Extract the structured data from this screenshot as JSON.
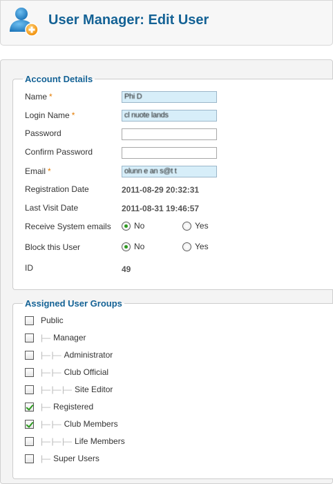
{
  "header": {
    "title": "User Manager: Edit User",
    "icon": "user-add-icon"
  },
  "account": {
    "legend": "Account Details",
    "fields": {
      "name": {
        "label": "Name",
        "required": "*",
        "value": "Phi    D"
      },
      "login": {
        "label": "Login Name",
        "required": "*",
        "value": "cl  nuote  lands"
      },
      "password": {
        "label": "Password",
        "value": ""
      },
      "confirm": {
        "label": "Confirm Password",
        "value": ""
      },
      "email": {
        "label": "Email",
        "required": "*",
        "value": "olunn   e  an   s@t       t"
      },
      "regdate": {
        "label": "Registration Date",
        "value": "2011-08-29 20:32:31"
      },
      "lastvisit": {
        "label": "Last Visit Date",
        "value": "2011-08-31 19:46:57"
      },
      "sysemails": {
        "label": "Receive System emails",
        "options": [
          "No",
          "Yes"
        ],
        "selected": "No"
      },
      "block": {
        "label": "Block this User",
        "options": [
          "No",
          "Yes"
        ],
        "selected": "No"
      },
      "id": {
        "label": "ID",
        "value": "49"
      }
    }
  },
  "groups": {
    "legend": "Assigned User Groups",
    "items": [
      {
        "label": "Public",
        "prefix": "",
        "checked": false
      },
      {
        "label": "Manager",
        "prefix": "|—",
        "checked": false
      },
      {
        "label": "Administrator",
        "prefix": "|— |—",
        "checked": false
      },
      {
        "label": "Club Official",
        "prefix": "|— |—",
        "checked": false
      },
      {
        "label": "Site Editor",
        "prefix": "|— |— |—",
        "checked": false
      },
      {
        "label": "Registered",
        "prefix": "|—",
        "checked": true
      },
      {
        "label": "Club Members",
        "prefix": "|— |—",
        "checked": true
      },
      {
        "label": "Life Members",
        "prefix": "|— |— |—",
        "checked": false
      },
      {
        "label": "Super Users",
        "prefix": "|—",
        "checked": false
      }
    ]
  },
  "colors": {
    "title": "#146295",
    "accent_orange": "#e47b00",
    "check_green": "#2b9a1e",
    "input_filled": "#d7eef9"
  }
}
